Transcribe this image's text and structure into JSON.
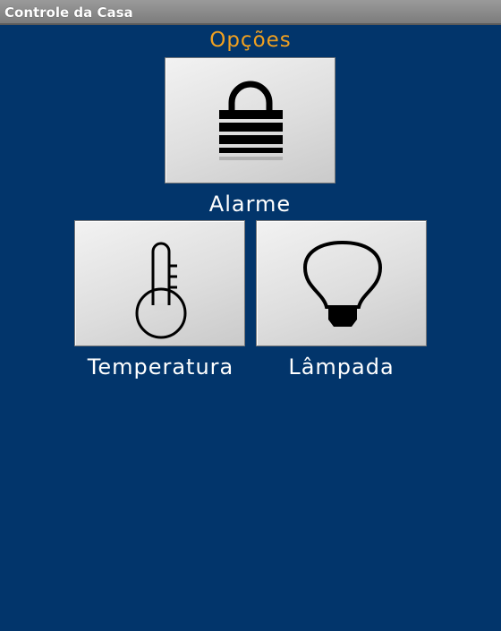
{
  "window": {
    "title": "Controle da Casa"
  },
  "main": {
    "heading": "Opções",
    "options": [
      {
        "label": "Alarme",
        "icon": "padlock-icon"
      },
      {
        "label": "Temperatura",
        "icon": "thermometer-icon"
      },
      {
        "label": "Lâmpada",
        "icon": "light-bulb-icon"
      }
    ]
  },
  "colors": {
    "background": "#02356b",
    "heading": "#f0a020",
    "label": "#ffffff",
    "tile": "#dcdcdc"
  }
}
